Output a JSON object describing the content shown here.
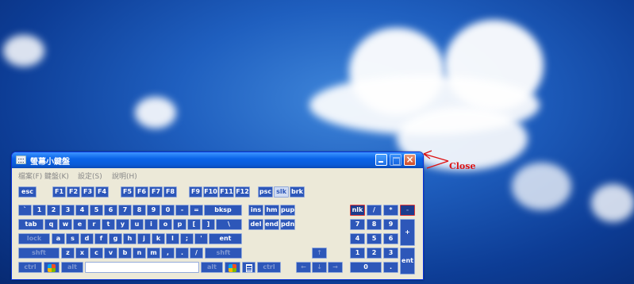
{
  "annotation": {
    "close_label": "Close"
  },
  "window": {
    "title": "螢幕小鍵盤",
    "menu": [
      "檔案(F)",
      "鍵盤(K)",
      "設定(S)",
      "說明(H)"
    ],
    "colors": {
      "key": "#2d57b9",
      "title_bar": "#0a5bd6",
      "close_accent": "#dd1111"
    }
  },
  "keys": {
    "esc": "esc",
    "f1": "F1",
    "f2": "F2",
    "f3": "F3",
    "f4": "F4",
    "f5": "F5",
    "f6": "F6",
    "f7": "F7",
    "f8": "F8",
    "f9": "F9",
    "f10": "F10",
    "f11": "F11",
    "f12": "F12",
    "psc": "psc",
    "slk": "slk",
    "brk": "brk",
    "backtick": "`",
    "n1": "1",
    "n2": "2",
    "n3": "3",
    "n4": "4",
    "n5": "5",
    "n6": "6",
    "n7": "7",
    "n8": "8",
    "n9": "9",
    "n0": "0",
    "minus": "-",
    "equals": "=",
    "bksp": "bksp",
    "ins": "ins",
    "hm": "hm",
    "pup": "pup",
    "nlk": "nlk",
    "kp_div": "/",
    "kp_mul": "*",
    "kp_minus": "-",
    "tab": "tab",
    "q": "q",
    "w": "w",
    "e": "e",
    "r": "r",
    "t": "t",
    "y": "y",
    "u": "u",
    "i": "i",
    "o": "o",
    "p": "p",
    "lbracket": "[",
    "rbracket": "]",
    "backslash": "\\",
    "del": "del",
    "end": "end",
    "pdn": "pdn",
    "kp7": "7",
    "kp8": "8",
    "kp9": "9",
    "kp_plus": "+",
    "lock": "lock",
    "a": "a",
    "s": "s",
    "d": "d",
    "f": "f",
    "g": "g",
    "h": "h",
    "j": "j",
    "k": "k",
    "l": "l",
    "semicolon": ";",
    "quote": "'",
    "ent": "ent",
    "kp4": "4",
    "kp5": "5",
    "kp6": "6",
    "shift_l": "shft",
    "z": "z",
    "x": "x",
    "c": "c",
    "v": "v",
    "b": "b",
    "n": "n",
    "m": "m",
    "comma": ",",
    "period": ".",
    "slash": "/",
    "shift_r": "shft",
    "up": "↑",
    "kp1": "1",
    "kp2": "2",
    "kp3": "3",
    "kp_ent": "ent",
    "ctrl_l": "ctrl",
    "alt_l": "alt",
    "alt_r": "alt",
    "ctrl_r": "ctrl",
    "left": "←",
    "down": "↓",
    "right": "→",
    "kp0": "0",
    "kp_dot": "."
  }
}
